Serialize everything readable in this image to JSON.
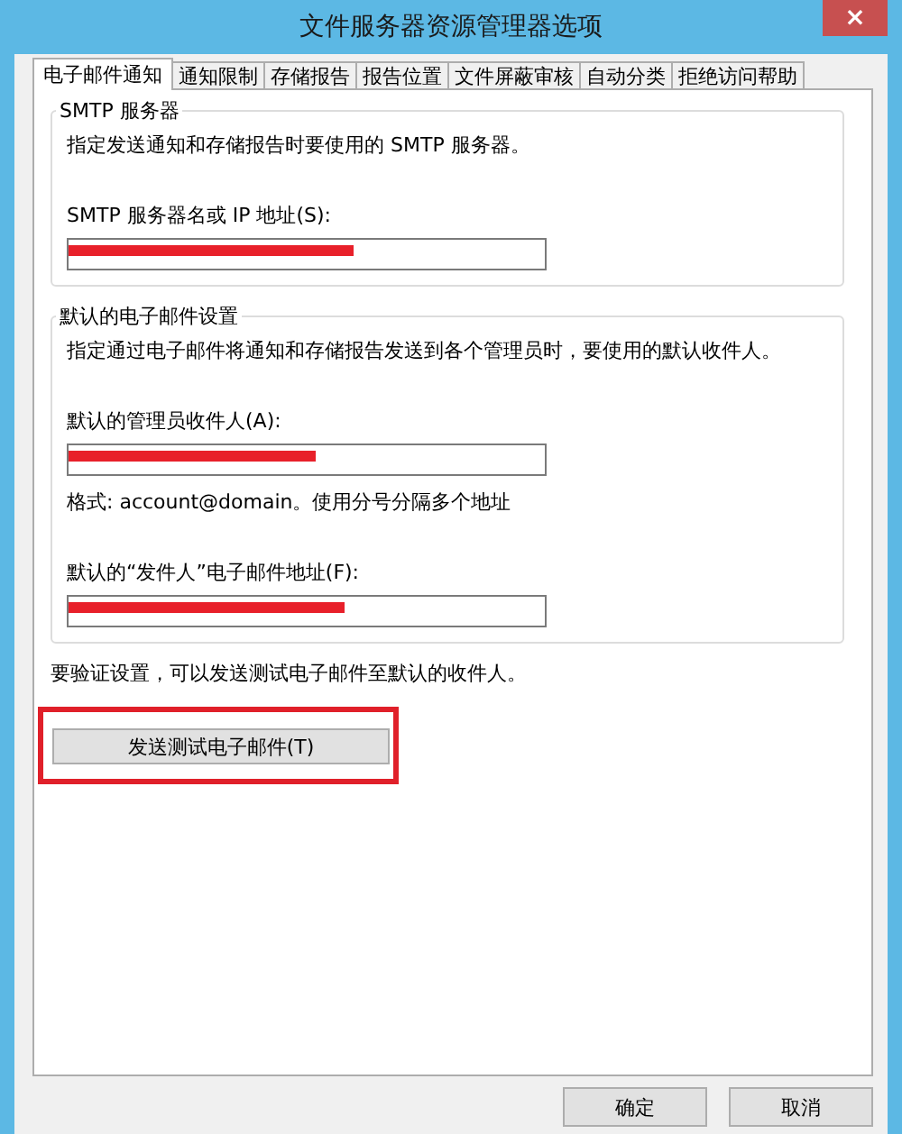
{
  "window": {
    "title": "文件服务器资源管理器选项",
    "close": "×"
  },
  "tabs": [
    {
      "label": "电子邮件通知",
      "selected": true
    },
    {
      "label": "通知限制",
      "selected": false
    },
    {
      "label": "存储报告",
      "selected": false
    },
    {
      "label": "报告位置",
      "selected": false
    },
    {
      "label": "文件屏蔽审核",
      "selected": false
    },
    {
      "label": "自动分类",
      "selected": false
    },
    {
      "label": "拒绝访问帮助",
      "selected": false
    }
  ],
  "groups": [
    {
      "title": "SMTP 服务器",
      "description": "指定发送通知和存储报告时要使用的 SMTP 服务器。",
      "fields": [
        {
          "label": "SMTP 服务器名或 IP 地址(S):",
          "redacted": true
        }
      ]
    },
    {
      "title": "默认的电子邮件设置",
      "description": "指定通过电子邮件将通知和存储报告发送到各个管理员时，要使用的默认收件人。",
      "fields": [
        {
          "label": "默认的管理员收件人(A):",
          "redacted": true,
          "hint": "格式: account@domain。使用分号分隔多个地址"
        },
        {
          "label": "默认的“发件人”电子邮件地址(F):",
          "redacted": true
        }
      ]
    }
  ],
  "test_note": "要验证设置，可以发送测试电子邮件至默认的收件人。",
  "test_button": {
    "label": "发送测试电子邮件(T)",
    "highlighted": true
  },
  "buttons": [
    "确定",
    "取消"
  ]
}
